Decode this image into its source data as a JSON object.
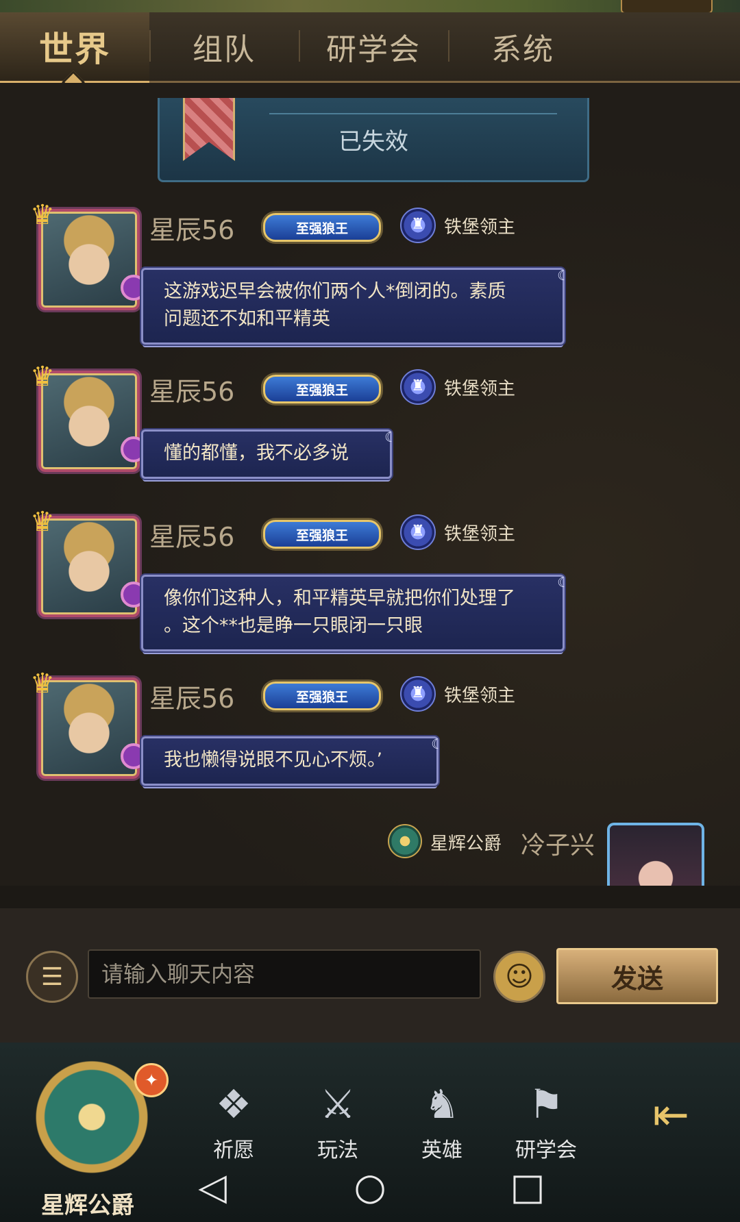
{
  "tabs": [
    {
      "label": "世界"
    },
    {
      "label": "组队"
    },
    {
      "label": "研学会"
    },
    {
      "label": "系统"
    }
  ],
  "expired_card": {
    "status": "已失效"
  },
  "messages": [
    {
      "name": "星辰56",
      "title_badge": "至强狼王",
      "rank": "铁堡领主",
      "lines": [
        "这游戏迟早会被你们两个人*倒闭的。素质",
        "问题还不如和平精英"
      ]
    },
    {
      "name": "星辰56",
      "title_badge": "至强狼王",
      "rank": "铁堡领主",
      "lines": [
        "懂的都懂，我不必多说"
      ]
    },
    {
      "name": "星辰56",
      "title_badge": "至强狼王",
      "rank": "铁堡领主",
      "lines": [
        "像你们这种人，和平精英早就把你们处理了",
        "。这个**也是睁一只眼闭一只眼"
      ]
    },
    {
      "name": "星辰56",
      "title_badge": "至强狼王",
      "rank": "铁堡领主",
      "lines": [
        "我也懒得说眼不见心不烦。’"
      ]
    }
  ],
  "self_message": {
    "rank": "星辉公爵",
    "name": "冷子兴"
  },
  "input": {
    "placeholder": "请输入聊天内容",
    "send_label": "发送"
  },
  "bottom_nav": {
    "guild_name": "星辉公爵",
    "items": [
      {
        "label": "祈愿",
        "icon": "wish-icon"
      },
      {
        "label": "玩法",
        "icon": "gameplay-icon"
      },
      {
        "label": "英雄",
        "icon": "hero-icon"
      },
      {
        "label": "研学会",
        "icon": "guild-banner-icon"
      }
    ]
  },
  "colors": {
    "accent_gold": "#d8b06a",
    "bubble_blue": "#283064",
    "send_button": "#c9a06a"
  }
}
